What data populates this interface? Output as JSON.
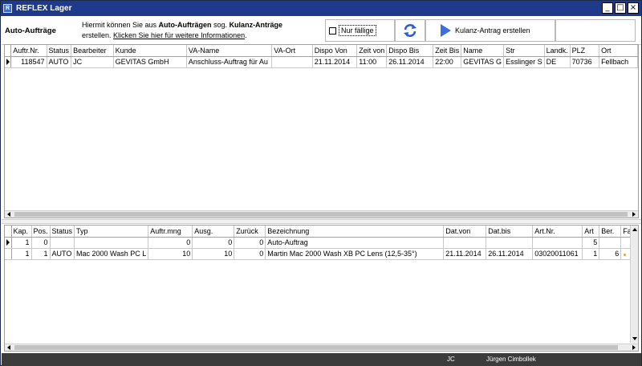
{
  "window": {
    "title": "REFLEX Lager",
    "app_icon": "app-icon",
    "buttons": [
      "_",
      "□",
      "×"
    ]
  },
  "toolbar": {
    "section_title": "Auto-Aufträge",
    "info_line1_pre": "Hiermit können Sie aus ",
    "info_line1_bold1": "Auto-Aufträgen",
    "info_line1_mid": " sog. ",
    "info_line1_bold2": "Kulanz-Anträge",
    "info_line2_pre": "erstellen. ",
    "info_link": "Klicken Sie hier für weitere Informationen",
    "info_line2_post": ".",
    "nur_faellige_label": "Nur fällige",
    "nur_faellige_checked": false,
    "refresh_icon": "refresh-icon",
    "kulanz_button_label": "Kulanz-Antrag erstellen",
    "kulanz_icon": "play-icon"
  },
  "orders_table": {
    "columns": [
      "Auftr.Nr.",
      "Status",
      "Bearbeiter",
      "Kunde",
      "VA-Name",
      "VA-Ort",
      "Dispo Von",
      "Zeit von",
      "Dispo Bis",
      "Zeit Bis",
      "Name",
      "Str",
      "Landk.",
      "PLZ",
      "Ort"
    ],
    "rows": [
      [
        "118547",
        "AUTO",
        "JC",
        "GEVITAS GmbH",
        "Anschluss-Auftrag für Au",
        "",
        "21.11.2014",
        "11:00",
        "26.11.2014",
        "22:00",
        "GEVITAS G",
        "Esslinger S",
        "DE",
        "70736",
        "Fellbach"
      ]
    ]
  },
  "positions_table": {
    "columns": [
      "Kap.",
      "Pos.",
      "Status",
      "Typ",
      "Auftr.mng",
      "Ausg.",
      "Zurück",
      "Bezeichnung",
      "Dat.von",
      "Dat.bis",
      "Art.Nr.",
      "Art",
      "Ber.",
      "Fak"
    ],
    "rows": [
      [
        "1",
        "0",
        "",
        "",
        "0",
        "0",
        "0",
        "Auto-Auftrag",
        "",
        "",
        "",
        "5",
        "",
        ""
      ],
      [
        "1",
        "1",
        "AUTO",
        "Mac 2000 Wash PC L",
        "10",
        "10",
        "0",
        "Martin Mac 2000 Wash XB PC Lens (12,5-35°)",
        "21.11.2014",
        "26.11.2014",
        "03020011061",
        "1",
        "6",
        ""
      ]
    ]
  },
  "status_bar": {
    "user_code": "JC",
    "user_name": "Jürgen Cimbollek"
  },
  "colors": {
    "titlebar": "#1f3a8a",
    "statusbar": "#3c3c3c",
    "accent_play": "#3d6ee0",
    "refresh": "#2a5bd7"
  }
}
